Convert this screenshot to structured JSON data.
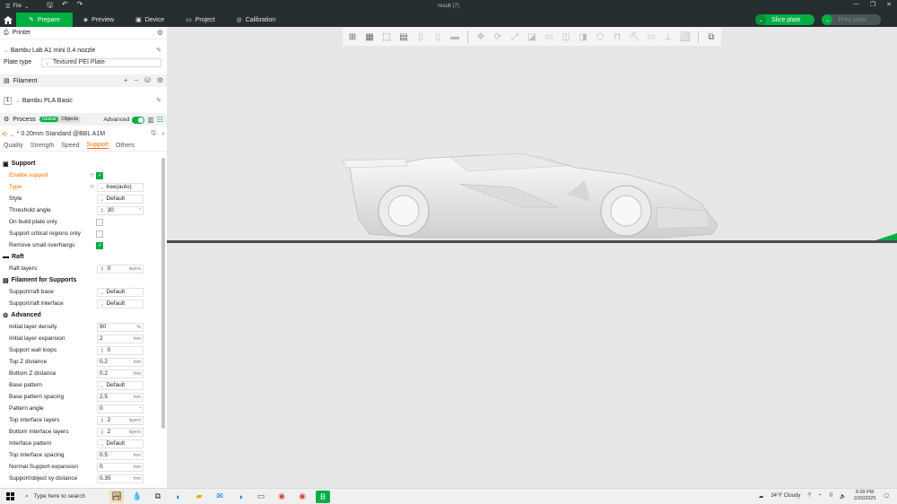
{
  "window": {
    "title": "result (7)",
    "file_menu": "File"
  },
  "topbar": {
    "tabs": [
      {
        "label": "Prepare",
        "icon": "prepare-icon"
      },
      {
        "label": "Preview",
        "icon": "preview-icon"
      },
      {
        "label": "Device",
        "icon": "device-icon"
      },
      {
        "label": "Project",
        "icon": "project-icon"
      },
      {
        "label": "Calibration",
        "icon": "calibration-icon"
      }
    ],
    "slice_label": "Slice plate",
    "print_label": "Print plate",
    "accent": "#00ae42"
  },
  "printer": {
    "header": "Printer",
    "name": "Bambu Lab A1 mini 0.4 nozzle",
    "plate_type_label": "Plate type",
    "plate_type_value": "Textured PEI Plate"
  },
  "filament": {
    "header": "Filament",
    "slot": "1",
    "name": "Bambu PLA Basic"
  },
  "process": {
    "header": "Process",
    "scope_global": "Global",
    "scope_objects": "Objects",
    "advanced_label": "Advanced",
    "preset": "* 0.20mm Standard @BBL A1M",
    "tabs": [
      "Quality",
      "Strength",
      "Speed",
      "Support",
      "Others"
    ],
    "active_tab": "Support"
  },
  "settings": {
    "support": {
      "title": "Support",
      "enable_support": "Enable support",
      "type": "Type",
      "type_value": "tree(auto)",
      "style": "Style",
      "style_value": "Default",
      "threshold_angle": "Threshold angle",
      "threshold_angle_value": "30",
      "threshold_angle_unit": "°",
      "on_build_plate_only": "On build plate only",
      "support_critical": "Support critical regions only",
      "remove_small": "Remove small overhangs"
    },
    "raft": {
      "title": "Raft",
      "raft_layers": "Raft layers",
      "raft_layers_value": "0",
      "raft_layers_unit": "layers"
    },
    "filament_supports": {
      "title": "Filament for Supports",
      "base": "Support/raft base",
      "base_value": "Default",
      "interface": "Support/raft interface",
      "interface_value": "Default"
    },
    "advanced": {
      "title": "Advanced",
      "rows": [
        {
          "label": "Initial layer density",
          "value": "90",
          "unit": "%"
        },
        {
          "label": "Initial layer expansion",
          "value": "2",
          "unit": "mm"
        },
        {
          "label": "Support wall loops",
          "value": "0",
          "unit": ""
        },
        {
          "label": "Top Z distance",
          "value": "0.2",
          "unit": "mm"
        },
        {
          "label": "Bottom Z distance",
          "value": "0.2",
          "unit": "mm"
        },
        {
          "label": "Base pattern",
          "value": "Default",
          "unit": ""
        },
        {
          "label": "Base pattern spacing",
          "value": "2.5",
          "unit": "mm"
        },
        {
          "label": "Pattern angle",
          "value": "0",
          "unit": "°"
        },
        {
          "label": "Top interface layers",
          "value": "2",
          "unit": "layers"
        },
        {
          "label": "Bottom interface layers",
          "value": "2",
          "unit": "layers"
        },
        {
          "label": "Interface pattern",
          "value": "Default",
          "unit": ""
        },
        {
          "label": "Top interface spacing",
          "value": "0.5",
          "unit": "mm"
        },
        {
          "label": "Normal Support expansion",
          "value": "0",
          "unit": "mm"
        },
        {
          "label": "Support/object xy distance",
          "value": "0.35",
          "unit": "mm"
        }
      ]
    }
  },
  "taskbar": {
    "search_placeholder": "Type here to search",
    "weather": "34°F  Cloudy",
    "time": "6:09 PM",
    "date": "2/20/2025"
  }
}
